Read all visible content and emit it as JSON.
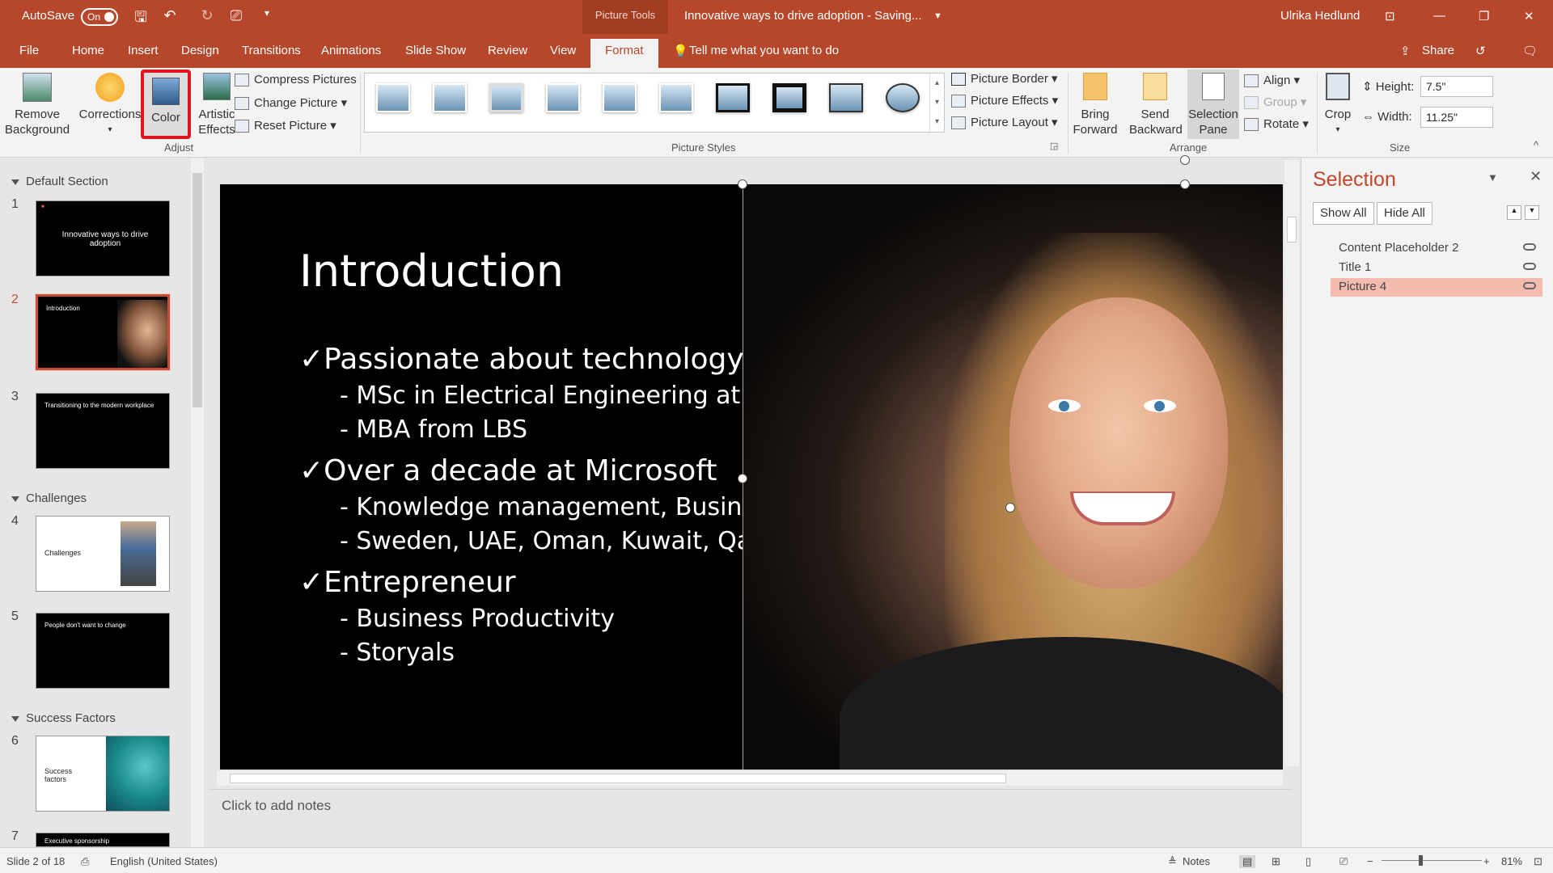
{
  "titlebar": {
    "autosave_label": "AutoSave",
    "autosave_state": "On",
    "context_tab": "Picture Tools",
    "doc_title": "Innovative ways to drive adoption  -  Saving...",
    "user": "Ulrika Hedlund"
  },
  "tabs": [
    "File",
    "Home",
    "Insert",
    "Design",
    "Transitions",
    "Animations",
    "Slide Show",
    "Review",
    "View",
    "Format"
  ],
  "active_tab": "Format",
  "tell_me": "Tell me what you want to do",
  "share_label": "Share",
  "ribbon": {
    "adjust": {
      "remove_bg": [
        "Remove",
        "Background"
      ],
      "corrections": "Corrections",
      "color": "Color",
      "artistic": [
        "Artistic",
        "Effects"
      ],
      "compress": "Compress Pictures",
      "change": "Change Picture",
      "reset": "Reset Picture",
      "group": "Adjust"
    },
    "styles": {
      "group": "Picture Styles"
    },
    "format_cmds": {
      "border": "Picture Border",
      "effects": "Picture Effects",
      "layout": "Picture Layout"
    },
    "arrange": {
      "bring": [
        "Bring",
        "Forward"
      ],
      "send": [
        "Send",
        "Backward"
      ],
      "pane": [
        "Selection",
        "Pane"
      ],
      "align": "Align",
      "group_cmd": "Group",
      "rotate": "Rotate",
      "group": "Arrange"
    },
    "size": {
      "crop": "Crop",
      "height_label": "Height:",
      "height_value": "7.5\"",
      "width_label": "Width:",
      "width_value": "11.25\"",
      "group": "Size"
    }
  },
  "sections": [
    "Default Section",
    "Challenges",
    "Success Factors"
  ],
  "thumbnails": {
    "s1": "Innovative ways to drive adoption",
    "s2": "Introduction",
    "s3": "Transitioning to the modern workplace",
    "s4": "Challenges",
    "s5": "People don't want to change",
    "s6": "Success factors",
    "s7": "Executive sponsorship",
    "nums": [
      "1",
      "2",
      "3",
      "4",
      "5",
      "6",
      "7"
    ]
  },
  "slide": {
    "title": "Introduction",
    "b1": "✓Passionate about technology",
    "b1a": "- MSc in Electrical Engineering at KTH",
    "b1b": "- MBA from LBS",
    "b2": "✓Over a decade at Microsoft",
    "b2a": "- Knowledge management, Business Intelligence, Productivity",
    "b2b": "- Sweden, UAE, Oman, Kuwait, Qatar, Bahrain",
    "b3": "✓Entrepreneur",
    "b3a": "- Business Productivity",
    "b3b": "- Storyals"
  },
  "notes_placeholder": "Click to add notes",
  "selection_pane": {
    "title": "Selection",
    "show_all": "Show All",
    "hide_all": "Hide All",
    "items": [
      "Content Placeholder 2",
      "Title 1",
      "Picture 4"
    ],
    "selected": "Picture 4"
  },
  "status": {
    "slide_info": "Slide 2 of 18",
    "language": "English (United States)",
    "notes": "Notes",
    "zoom": "81%"
  },
  "colors": {
    "accent": "#b7472a",
    "highlight": "#f4bcae",
    "callout": "#e0141e"
  }
}
